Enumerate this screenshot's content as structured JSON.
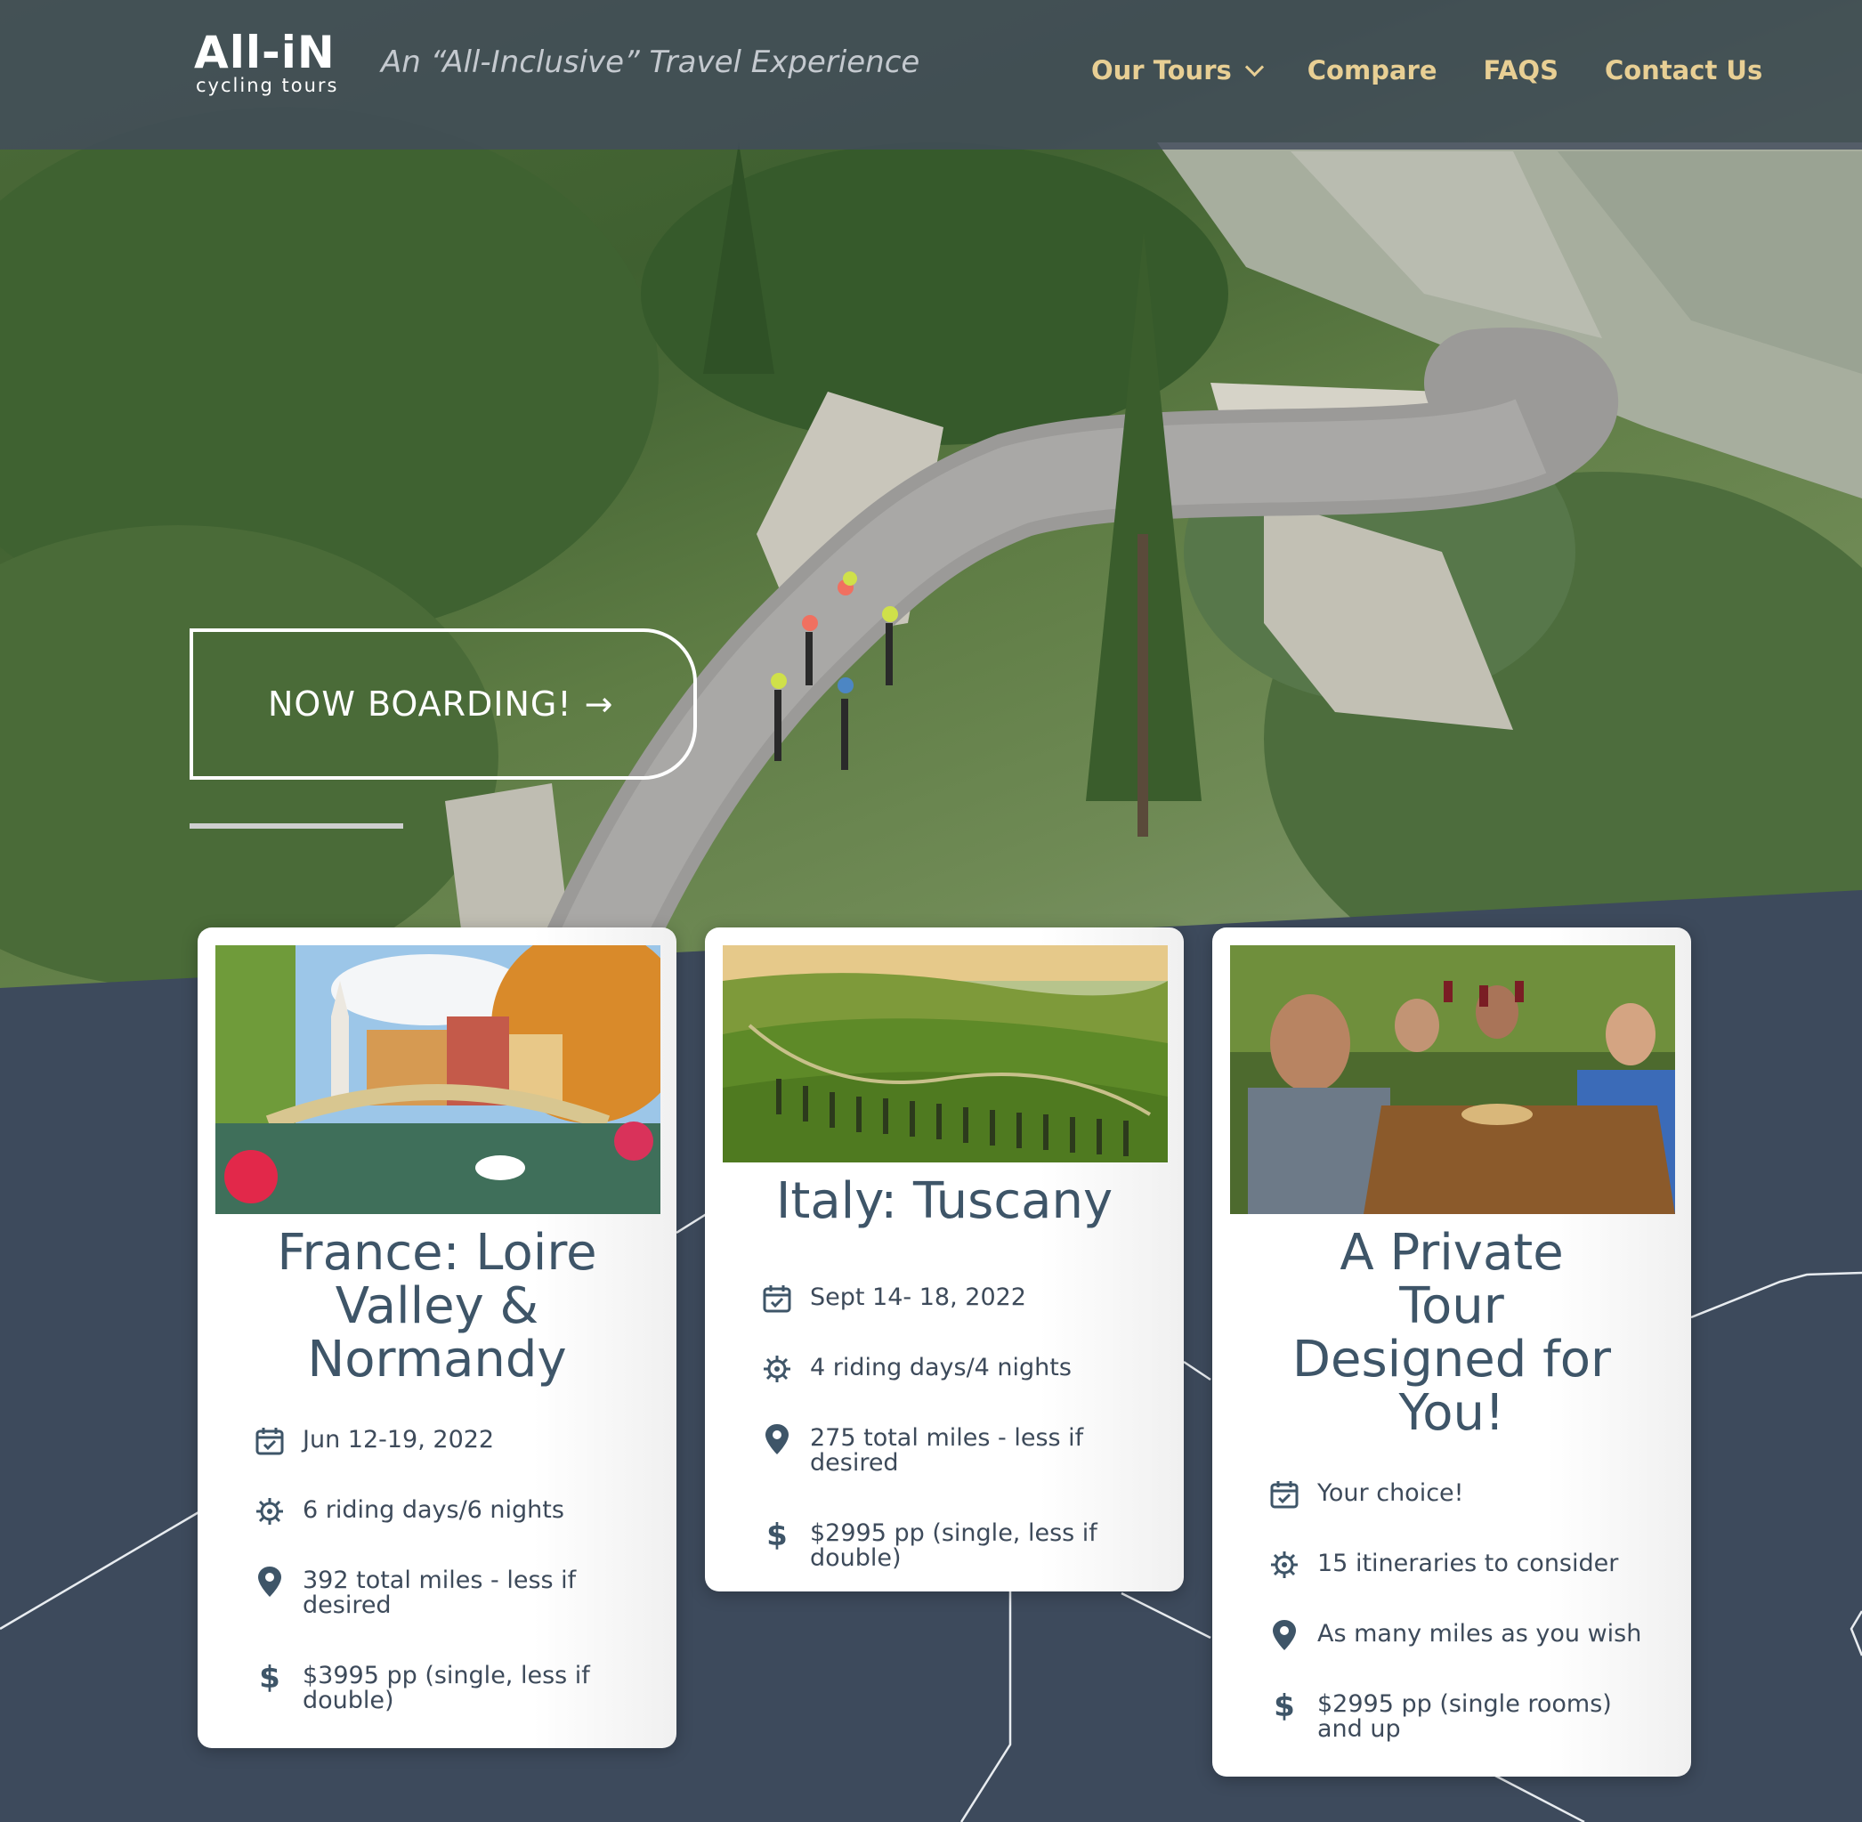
{
  "header": {
    "logo_main": "All-iN",
    "logo_sub": "cycling tours",
    "tagline": "An “All-Inclusive” Travel Experience",
    "nav": [
      {
        "label": "Our Tours",
        "dropdown": true
      },
      {
        "label": "Compare"
      },
      {
        "label": "FAQS"
      },
      {
        "label": "Contact Us"
      }
    ]
  },
  "hero": {
    "cta_label": "NOW BOARDING!",
    "cta_arrow": "→"
  },
  "colors": {
    "header_bg": "#424c5c",
    "nav_text": "#e8cf94",
    "page_bg": "#3d4a5c",
    "title_text": "#3e5568"
  },
  "tours": [
    {
      "title": [
        "France: Loire",
        "Valley &",
        "Normandy"
      ],
      "features": [
        {
          "icon": "calendar-check-icon",
          "text": "Jun 12-19, 2022"
        },
        {
          "icon": "cycling-gear-icon",
          "text": "6 riding days/6 nights"
        },
        {
          "icon": "map-pin-icon",
          "text": "392 total miles - less if desired"
        },
        {
          "icon": "dollar-icon",
          "text": "$3995 pp (single, less if double)"
        }
      ]
    },
    {
      "title": [
        "Italy: Tuscany"
      ],
      "features": [
        {
          "icon": "calendar-check-icon",
          "text": "Sept 14- 18, 2022"
        },
        {
          "icon": "cycling-gear-icon",
          "text": "4 riding days/4 nights"
        },
        {
          "icon": "map-pin-icon",
          "text": "275 total miles - less if desired"
        },
        {
          "icon": "dollar-icon",
          "text": "$2995 pp (single, less if double)"
        }
      ]
    },
    {
      "title": [
        "A Private",
        "Tour",
        "Designed for",
        "You!"
      ],
      "features": [
        {
          "icon": "calendar-check-icon",
          "text": "Your choice!"
        },
        {
          "icon": "cycling-gear-icon",
          "text": "15 itineraries to consider"
        },
        {
          "icon": "map-pin-icon",
          "text": "As many miles as you wish"
        },
        {
          "icon": "dollar-icon",
          "text": "$2995 pp (single rooms) and up"
        }
      ]
    }
  ]
}
